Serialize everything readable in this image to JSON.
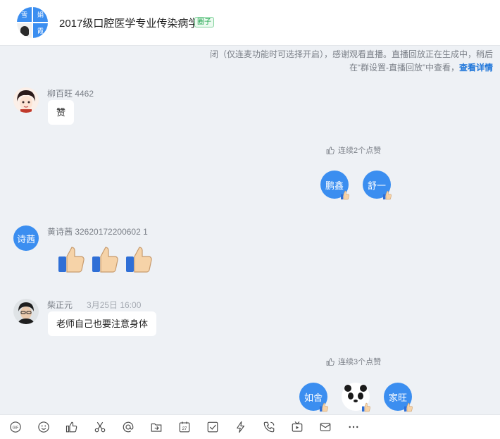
{
  "header": {
    "title": "2017级口腔医学专业传染病学",
    "tag": "圈子",
    "avatar_cells": [
      "雪",
      "娟",
      "霞"
    ]
  },
  "notice": {
    "text": "闭（仅连麦功能时可选择开启），感谢观看直播。直播回放正在生成中，稍后在“群设置-直播回放”中查看，",
    "link": "查看详情"
  },
  "messages": [
    {
      "sender": "柳百旺 4462",
      "text": "赞"
    },
    {
      "sender": "黄诗茜 32620172200602 1",
      "avatar_text": "诗茜"
    },
    {
      "sender": "柴正元",
      "time": "3月25日 16:00",
      "text": "老师自己也要注意身体"
    }
  ],
  "likes": [
    {
      "summary": "连续2个点赞",
      "people": [
        "鹏鑫",
        "舒一"
      ]
    },
    {
      "summary": "连续3个点赞",
      "people": [
        "如舍",
        "",
        "家旺"
      ]
    }
  ],
  "toolbar": {
    "icons": [
      "gif-icon",
      "emoji-icon",
      "thumbs-up-icon",
      "scissors-icon",
      "at-icon",
      "share-file-icon",
      "calendar-icon",
      "checkbox-icon",
      "lightning-icon",
      "phone-icon",
      "video-icon",
      "mail-icon",
      "more-icon"
    ],
    "calendar_day": "27",
    "gif_label": "GIF"
  }
}
